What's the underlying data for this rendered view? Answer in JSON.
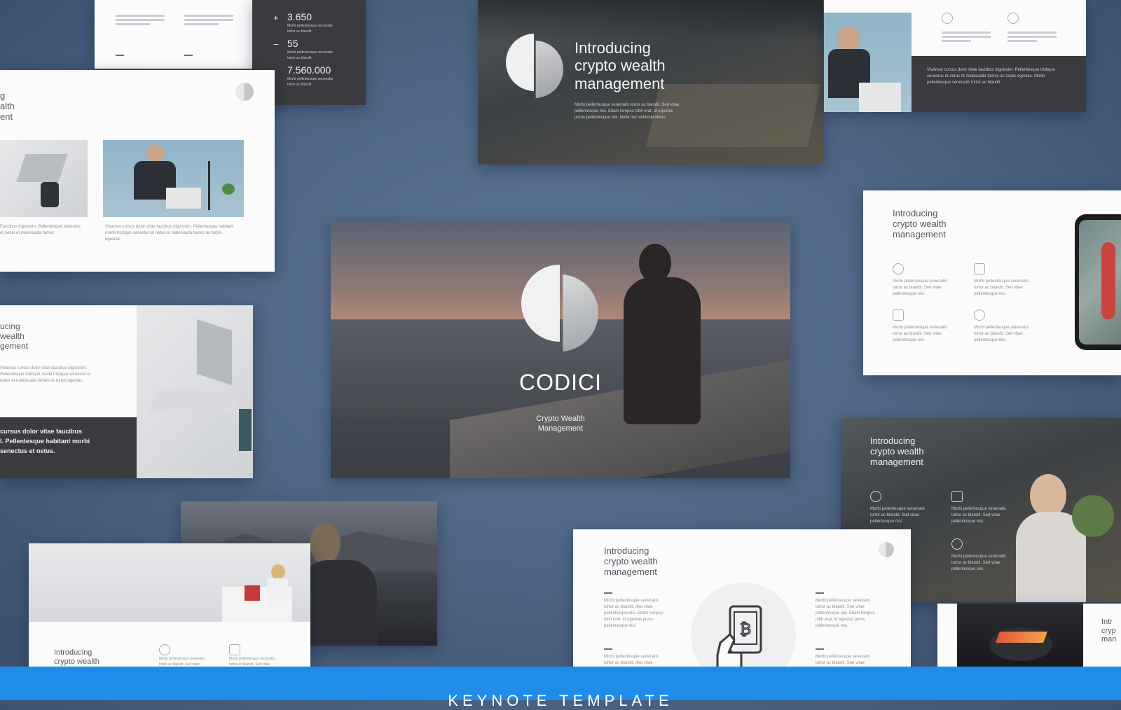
{
  "stats": [
    {
      "sign": "+",
      "value": "3.650",
      "caption": "Morbi pellentesque senenatis tortor ac blandit."
    },
    {
      "sign": "−",
      "value": "55",
      "caption": "Morbi pellentesque senenatis tortor ac blandit."
    },
    {
      "sign": "",
      "value": "7.560.000",
      "caption": "Morbi pellentesque senenatis tortor ac blandit."
    }
  ],
  "top_center": {
    "title": "Introducing crypto wealth management",
    "body": "Morbi pellentesque senenatis tortor ac blandit. Sed vitae pellentesque nisi. Etiam tempus nibh erat, id egestas purus pellentesque nisi. Nulla nec vehicula libero."
  },
  "top_right": {
    "dark_text": "Vivamus cursus dolor vitae faucibus dignissim. Pellentesque tristique senectus et netus et malesuada fames ac turpis egestas. Morbi pellentesque senenatis tortor ac blandit."
  },
  "left_mid": {
    "title_frag": "g\nalth\nent",
    "caption_a": "Faucibus dignissim. Pellentesque senectus et netus et malesuada fames",
    "caption_b": "Vivamus cursus dolor vitae faucibus dignissim. Pellentesque habitant morbi tristique senectus et netus et malesuada fames ac turpis egestas."
  },
  "left_lower": {
    "title_frag": "ucing\nwealth\ngement",
    "body": "Vivamus cursus dolor vitae faucibus dignissim. Pellentesque habitant morbi tristique senectus et netus et malesuada fames ac turpis egestas.",
    "bold": "cursus dolor vitae faucibus\nl. Pellentesque habitant morbi\nsenectus et netus."
  },
  "hero": {
    "brand": "CODICI",
    "subtitle_line1": "Crypto Wealth",
    "subtitle_line2": "Management"
  },
  "right_mid": {
    "title": "Introducing crypto wealth management",
    "item_text": "Morbi pellentesque senenatis tortor ac blandit. Sed vitae pellentesque nisi."
  },
  "right_lower": {
    "title": "Introducing crypto wealth management",
    "item_text": "Morbi pellentesque senenatis tortor ac blandit. Sed vitae pellentesque nisi."
  },
  "bottom_center": {
    "title": "Introducing crypto wealth management",
    "col_text": "Morbi pellentesque senenatis tortor ac blandit. Sed vitae pellentesque nisi. Etiam tempus nibh erat, id egestas purus pellentesque nisi."
  },
  "bottom_left": {
    "title": "Introducing crypto wealth management",
    "item_text": "Morbi pellentesque senenatis tortor ac blandit. Sed vitae pellentesque nisi."
  },
  "bottom_right": {
    "title_frag": "Intr\ncryp\nman"
  },
  "footer": {
    "label": "KEYNOTE TEMPLATE"
  },
  "colors": {
    "background": "#4f6686",
    "footer_bar": "#1e8ce8",
    "slide_white": "#fbfbfc",
    "slide_dark": "#3a3b3f"
  }
}
